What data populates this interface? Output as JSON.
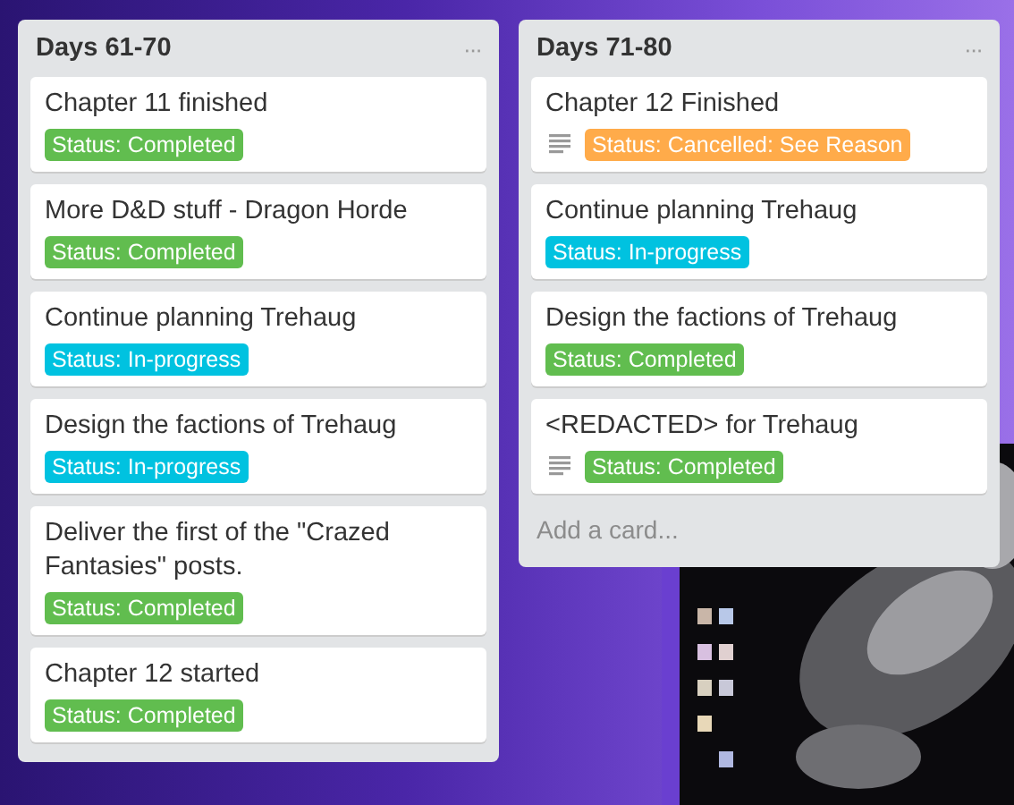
{
  "lists": [
    {
      "title": "Days 61-70",
      "menu": "···",
      "cards": [
        {
          "title": "Chapter 11 finished",
          "has_description": false,
          "label": {
            "text": "Status: Completed",
            "color": "#61bd4f"
          }
        },
        {
          "title": "More D&D stuff - Dragon Horde",
          "has_description": false,
          "label": {
            "text": "Status: Completed",
            "color": "#61bd4f"
          }
        },
        {
          "title": "Continue planning Trehaug",
          "has_description": false,
          "label": {
            "text": "Status: In-progress",
            "color": "#00c2e0"
          }
        },
        {
          "title": "Design the factions of Trehaug",
          "has_description": false,
          "label": {
            "text": "Status: In-progress",
            "color": "#00c2e0"
          }
        },
        {
          "title": "Deliver the first of the \"Crazed Fantasies\" posts.",
          "has_description": false,
          "label": {
            "text": "Status: Completed",
            "color": "#61bd4f"
          }
        },
        {
          "title": "Chapter 12 started",
          "has_description": false,
          "label": {
            "text": "Status: Completed",
            "color": "#61bd4f"
          }
        }
      ]
    },
    {
      "title": "Days 71-80",
      "menu": "···",
      "cards": [
        {
          "title": "Chapter 12 Finished",
          "has_description": true,
          "label": {
            "text": "Status: Cancelled: See Reason",
            "color": "#ffab4a"
          }
        },
        {
          "title": "Continue planning Trehaug",
          "has_description": false,
          "label": {
            "text": "Status: In-progress",
            "color": "#00c2e0"
          }
        },
        {
          "title": "Design the factions of Trehaug",
          "has_description": false,
          "label": {
            "text": "Status: Completed",
            "color": "#61bd4f"
          }
        },
        {
          "title": "<REDACTED> for Trehaug",
          "has_description": true,
          "label": {
            "text": "Status: Completed",
            "color": "#61bd4f"
          }
        }
      ],
      "add_card": "Add a card..."
    }
  ]
}
